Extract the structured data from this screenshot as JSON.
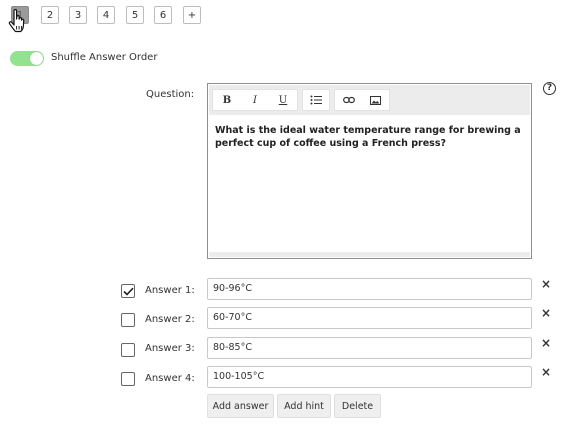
{
  "question_tabs": [
    "1",
    "2",
    "3",
    "4",
    "5",
    "6",
    "+"
  ],
  "active_tab": "1",
  "shuffle": {
    "label": "Shuffle Answer Order",
    "enabled": true
  },
  "question": {
    "label": "Question:",
    "text": "What is the ideal water temperature range for brewing a perfect cup of coffee using a French press?",
    "toolbar": {
      "bold": "B",
      "italic": "I",
      "underline": "U"
    }
  },
  "help_icon": "?",
  "answers": [
    {
      "label": "Answer 1:",
      "value": "90-96°C",
      "checked": true
    },
    {
      "label": "Answer 2:",
      "value": "60-70°C",
      "checked": false
    },
    {
      "label": "Answer 3:",
      "value": "80-85°C",
      "checked": false
    },
    {
      "label": "Answer 4:",
      "value": "100-105°C",
      "checked": false
    }
  ],
  "delete_symbol": "×",
  "buttons": {
    "add_answer": "Add answer",
    "add_hint": "Add hint",
    "delete": "Delete"
  },
  "colors": {
    "toggle_on": "#92e38f",
    "active_tab": "#9a9a9a"
  }
}
